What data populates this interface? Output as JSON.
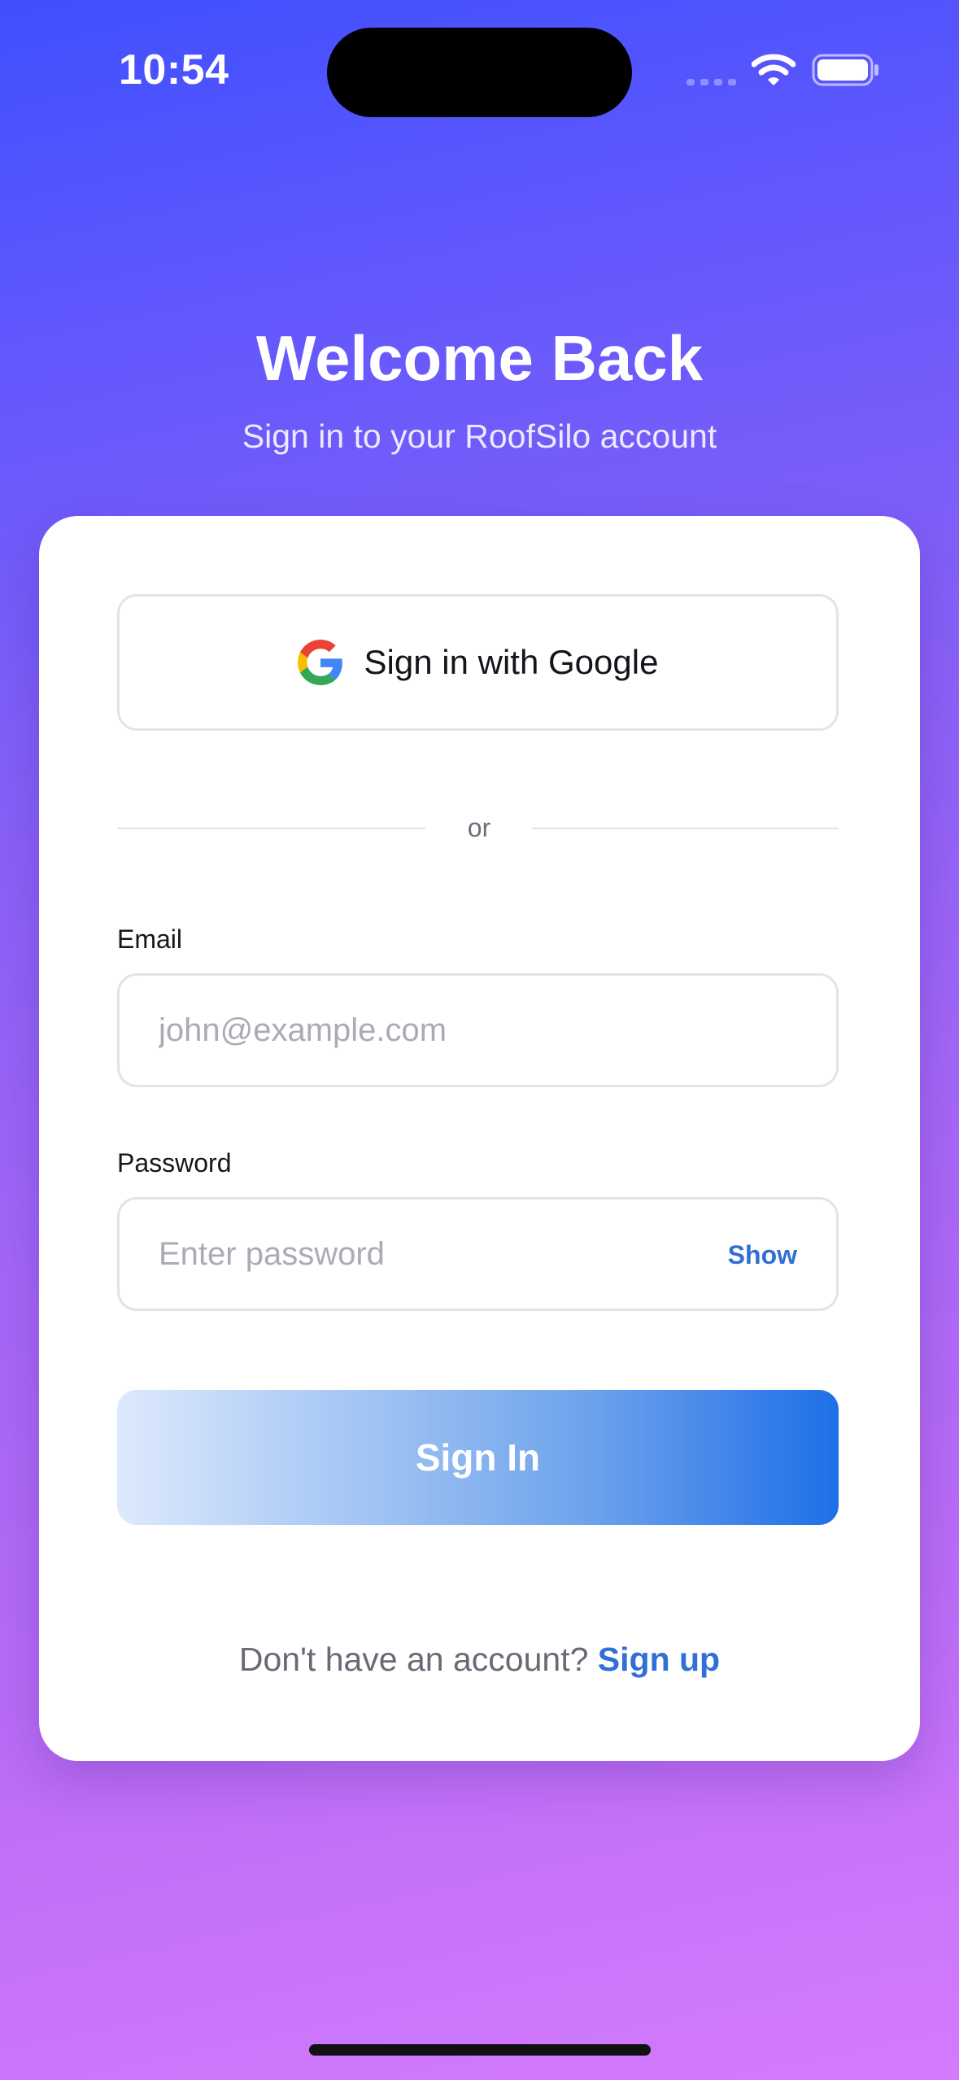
{
  "status_bar": {
    "time": "10:54"
  },
  "header": {
    "title": "Welcome Back",
    "subtitle": "Sign in to your RoofSilo account"
  },
  "card": {
    "google_button_label": "Sign in with Google",
    "divider_text": "or",
    "email": {
      "label": "Email",
      "placeholder": "john@example.com",
      "value": ""
    },
    "password": {
      "label": "Password",
      "placeholder": "Enter password",
      "value": "",
      "toggle_label": "Show"
    },
    "signin_button_label": "Sign In",
    "footer": {
      "prompt": "Don't have an account?",
      "link": "Sign up"
    }
  },
  "colors": {
    "accent": "#2f6fd6",
    "background_top": "#3f50fe",
    "background_bottom": "#d47bfe",
    "button_gradient_end": "#1e6fe8"
  },
  "icons": {
    "google": "google-icon",
    "wifi": "wifi-icon",
    "battery": "battery-icon",
    "signal": "signal-icon"
  }
}
